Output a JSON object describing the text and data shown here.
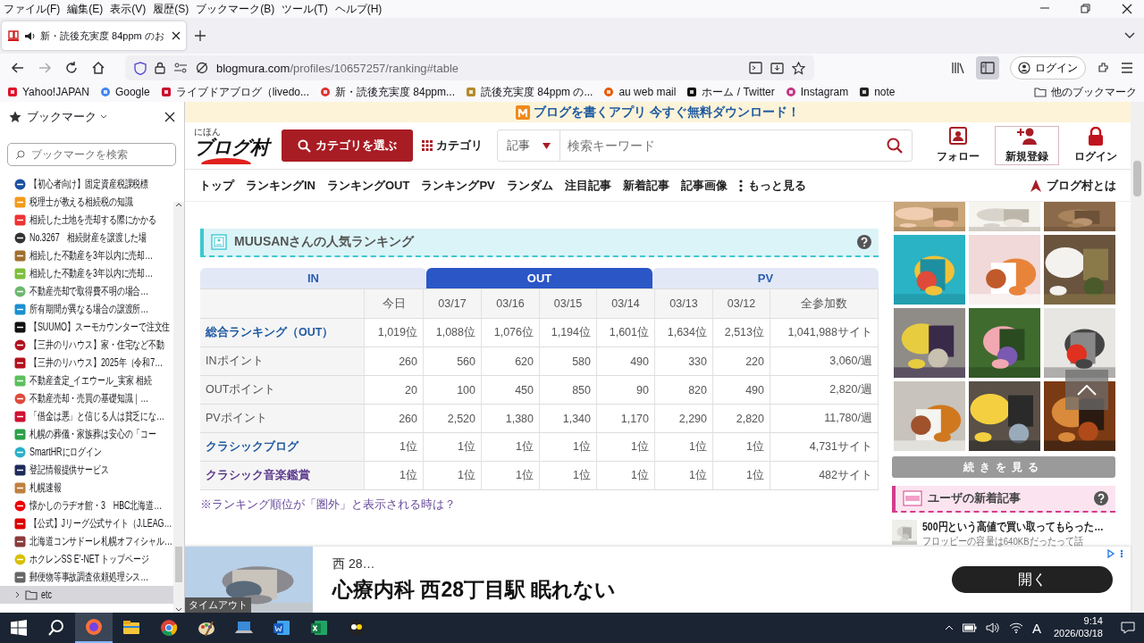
{
  "menu_bar": [
    "ファイル(F)",
    "編集(E)",
    "表示(V)",
    "履歴(S)",
    "ブックマーク(B)",
    "ツール(T)",
    "ヘルプ(H)"
  ],
  "tabs": [
    {
      "title": "新・読後充実度 84ppm のお",
      "selected": true
    }
  ],
  "address_bar": {
    "domain": "blogmura.com",
    "path": "/profiles/10657257/ranking#table"
  },
  "toolbar": {
    "sidebar_on": true,
    "account_label": "ログイン"
  },
  "bookmarks_bar": [
    {
      "label": "Yahoo!JAPAN"
    },
    {
      "label": "Google"
    },
    {
      "label": "ライブドアブログ（livedo..."
    },
    {
      "label": "新・読後充実度 84ppm..."
    },
    {
      "label": "読後充実度 84ppm の..."
    },
    {
      "label": "au web mail"
    },
    {
      "label": "ホーム / Twitter"
    },
    {
      "label": "Instagram"
    },
    {
      "label": "note"
    }
  ],
  "other_bookmarks": "他のブックマーク",
  "sidebar": {
    "title": "ブックマーク",
    "search_placeholder": "ブックマークを検索",
    "items": [
      {
        "label": "【初心者向け】固定資産税課税標",
        "kind": "bookmark",
        "selected": false
      },
      {
        "label": "税理士が教える相続税の知識",
        "kind": "bookmark",
        "selected": false
      },
      {
        "label": "相続した土地を売却する際にかかる",
        "kind": "bookmark",
        "selected": false
      },
      {
        "label": "No.3267　相続財産を譲渡した場",
        "kind": "bookmark",
        "selected": false
      },
      {
        "label": "相続した不動産を3年以内に売却…",
        "kind": "bookmark",
        "selected": false
      },
      {
        "label": "相続した不動産を3年以内に売却…",
        "kind": "bookmark",
        "selected": false
      },
      {
        "label": "不動産売却で取得費不明の場合…",
        "kind": "bookmark",
        "selected": false
      },
      {
        "label": "所有期間が異なる場合の譲渡所…",
        "kind": "bookmark",
        "selected": false
      },
      {
        "label": "【SUUMO】スーモカウンターで注文住",
        "kind": "bookmark",
        "selected": false
      },
      {
        "label": "【三井のリハウス】家・住宅など不動",
        "kind": "bookmark",
        "selected": false
      },
      {
        "label": "【三井のリハウス】2025年（令和7…",
        "kind": "bookmark",
        "selected": false
      },
      {
        "label": "不動産査定_イエウール_実家 相続",
        "kind": "bookmark",
        "selected": false
      },
      {
        "label": "不動産売却・売買の基礎知識｜…",
        "kind": "bookmark",
        "selected": false
      },
      {
        "label": "「借金は悪」と信じる人は貧乏にな…",
        "kind": "bookmark",
        "selected": false
      },
      {
        "label": "札幌の葬儀・家族葬は安心の「コー",
        "kind": "bookmark",
        "selected": false
      },
      {
        "label": "SmartHRにログイン",
        "kind": "bookmark",
        "selected": false
      },
      {
        "label": "登記情報提供サービス",
        "kind": "bookmark",
        "selected": false
      },
      {
        "label": "札幌速報",
        "kind": "bookmark",
        "selected": false
      },
      {
        "label": "懐かしのラヂオ館・3　HBC北海道…",
        "kind": "bookmark",
        "selected": false
      },
      {
        "label": "【公式】Jリーグ公式サイト（J.LEAG…",
        "kind": "bookmark",
        "selected": false
      },
      {
        "label": "北海道コンサドーレ札幌オフィシャル…",
        "kind": "bookmark",
        "selected": false
      },
      {
        "label": "ホクレンSS E'-NET トップページ",
        "kind": "bookmark",
        "selected": false
      },
      {
        "label": "郵便物等事故調査依頼処理シス…",
        "kind": "bookmark",
        "selected": false
      },
      {
        "label": "etc",
        "kind": "folder",
        "selected": true,
        "expanded": false
      }
    ]
  },
  "page": {
    "banner": "ブログを書くアプリ 今すぐ無料ダウンロード！",
    "logo_small": "にほん",
    "logo": "ブログ村",
    "category_button": "カテゴリを選ぶ",
    "category_link": "カテゴリ",
    "search_scope": "記事",
    "search_placeholder": "検索キーワード",
    "header_actions": [
      {
        "label": "フォロー",
        "kind": "follow",
        "outlined": false
      },
      {
        "label": "新規登録",
        "kind": "register",
        "outlined": true
      },
      {
        "label": "ログイン",
        "kind": "login",
        "outlined": false
      }
    ],
    "nav": [
      {
        "label": "トップ",
        "kind": "link"
      },
      {
        "label": "ランキングIN",
        "kind": "link"
      },
      {
        "label": "ランキングOUT",
        "kind": "link"
      },
      {
        "label": "ランキングPV",
        "kind": "link"
      },
      {
        "label": "ランダム",
        "kind": "link"
      },
      {
        "label": "注目記事",
        "kind": "link"
      },
      {
        "label": "新着記事",
        "kind": "link"
      },
      {
        "label": "記事画像",
        "kind": "link"
      },
      {
        "label": "もっと見る",
        "kind": "more"
      }
    ],
    "about": "ブログ村とは",
    "ranking": {
      "title": "MUUSANさんの人気ランキング",
      "tabs": [
        {
          "label": "IN",
          "selected": false
        },
        {
          "label": "OUT",
          "selected": true
        },
        {
          "label": "PV",
          "selected": false
        }
      ],
      "columns": [
        "今日",
        "03/17",
        "03/16",
        "03/15",
        "03/14",
        "03/13",
        "03/12",
        "全参加数"
      ],
      "rows": [
        {
          "label": "総合ランキング（OUT）",
          "kind": "link",
          "visited": false,
          "cells": [
            "1,019位",
            "1,088位",
            "1,076位",
            "1,194位",
            "1,601位",
            "1,634位",
            "2,513位",
            "1,041,988サイト"
          ]
        },
        {
          "label": "INポイント",
          "kind": "text",
          "visited": false,
          "cells": [
            "260",
            "560",
            "620",
            "580",
            "490",
            "330",
            "220",
            "3,060/週"
          ]
        },
        {
          "label": "OUTポイント",
          "kind": "text",
          "visited": false,
          "cells": [
            "20",
            "100",
            "450",
            "850",
            "90",
            "820",
            "490",
            "2,820/週"
          ]
        },
        {
          "label": "PVポイント",
          "kind": "text",
          "visited": false,
          "cells": [
            "260",
            "2,520",
            "1,380",
            "1,340",
            "1,170",
            "2,290",
            "2,820",
            "11,780/週"
          ]
        },
        {
          "label": "クラシックブログ",
          "kind": "link",
          "visited": false,
          "cells": [
            "1位",
            "1位",
            "1位",
            "1位",
            "1位",
            "1位",
            "1位",
            "4,731サイト"
          ]
        },
        {
          "label": "クラシック音楽鑑賞",
          "kind": "link",
          "visited": true,
          "cells": [
            "1位",
            "1位",
            "1位",
            "1位",
            "1位",
            "1位",
            "1位",
            "482サイト"
          ]
        }
      ],
      "note": "※ランキング順位が「圏外」と表示される時は？"
    },
    "more_button": "続きを見る",
    "new_posts": {
      "title": "ユーザの新着記事",
      "post_title": "500円という高値で買い取ってもらった…",
      "post_excerpt": "フロッピーの容量は640KBだったって話"
    },
    "ad": {
      "photo_label": "タイムアウト",
      "source": "西 28…",
      "headline": "心療内科 西28丁目駅 眠れない",
      "button": "開く"
    }
  },
  "taskbar": {
    "apps": [
      {
        "kind": "firefox",
        "selected": true
      },
      {
        "kind": "explorer",
        "selected": false
      },
      {
        "kind": "chrome",
        "selected": false
      },
      {
        "kind": "paint",
        "selected": false
      },
      {
        "kind": "laptop",
        "selected": false
      },
      {
        "kind": "word",
        "selected": false
      },
      {
        "kind": "excel",
        "selected": false
      },
      {
        "kind": "app",
        "selected": false
      }
    ],
    "ime": "A",
    "time": "9:14",
    "date": "2026/03/18"
  }
}
